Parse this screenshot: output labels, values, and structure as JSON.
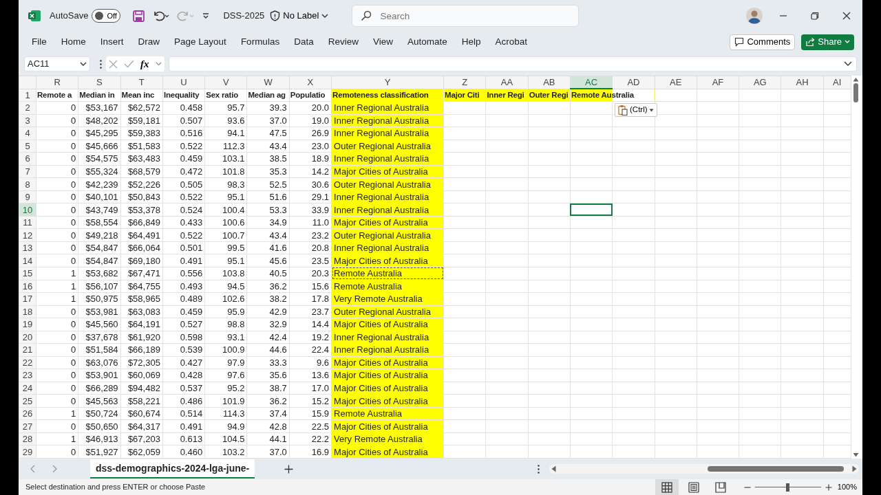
{
  "title_bar": {
    "autosave_label": "AutoSave",
    "autosave_on": false,
    "autosave_state": "Off",
    "file_name": "DSS-2025",
    "sensitivity": "No Label",
    "search_placeholder": "Search"
  },
  "ribbon_tabs": [
    "File",
    "Home",
    "Insert",
    "Draw",
    "Page Layout",
    "Formulas",
    "Data",
    "Review",
    "View",
    "Automate",
    "Help",
    "Acrobat"
  ],
  "ribbon_buttons": {
    "comments": "Comments",
    "share": "Share"
  },
  "formula_bar": {
    "name_box": "AC11",
    "function_symbol": "fx"
  },
  "sheet": {
    "columns": [
      {
        "label": "R",
        "selected": false
      },
      {
        "label": "S",
        "selected": false
      },
      {
        "label": "T",
        "selected": false
      },
      {
        "label": "U",
        "selected": false
      },
      {
        "label": "V",
        "selected": false
      },
      {
        "label": "W",
        "selected": false
      },
      {
        "label": "X",
        "selected": false
      },
      {
        "label": "Y",
        "selected": false
      },
      {
        "label": "Z",
        "selected": false
      },
      {
        "label": "AA",
        "selected": false
      },
      {
        "label": "AB",
        "selected": false
      },
      {
        "label": "AC",
        "selected": true
      },
      {
        "label": "AD",
        "selected": false
      },
      {
        "label": "AE",
        "selected": false
      },
      {
        "label": "AF",
        "selected": false
      },
      {
        "label": "AG",
        "selected": false
      },
      {
        "label": "AH",
        "selected": false
      },
      {
        "label": "AI",
        "selected": false
      }
    ],
    "header_row": {
      "number": "1",
      "cells": [
        {
          "text": "Remote a",
          "highlighted": false
        },
        {
          "text": "Median in",
          "highlighted": false
        },
        {
          "text": "Mean inc",
          "highlighted": false
        },
        {
          "text": "Inequality",
          "highlighted": false
        },
        {
          "text": "Sex ratio",
          "highlighted": false
        },
        {
          "text": "Median ag",
          "highlighted": false
        },
        {
          "text": "Populatio",
          "highlighted": false
        },
        {
          "text": "Remoteness classification",
          "highlighted": true
        },
        {
          "text": "Major Citi",
          "highlighted": true
        },
        {
          "text": "Inner Regi",
          "highlighted": true
        },
        {
          "text": "Outer Regi",
          "highlighted": true
        },
        {
          "text": "Remote Australia",
          "highlighted": true
        }
      ]
    },
    "rows": [
      {
        "number": "2",
        "selected": false,
        "copied": false,
        "values": [
          "0",
          "$53,167",
          "$62,572",
          "0.458",
          "95.7",
          "39.3",
          "20.0"
        ],
        "classification": "Inner Regional Australia"
      },
      {
        "number": "3",
        "selected": false,
        "copied": false,
        "values": [
          "0",
          "$48,202",
          "$59,181",
          "0.507",
          "93.6",
          "37.0",
          "19.0"
        ],
        "classification": "Inner Regional Australia"
      },
      {
        "number": "4",
        "selected": false,
        "copied": false,
        "values": [
          "0",
          "$45,295",
          "$59,383",
          "0.516",
          "94.1",
          "47.5",
          "26.9"
        ],
        "classification": "Inner Regional Australia"
      },
      {
        "number": "5",
        "selected": false,
        "copied": false,
        "values": [
          "0",
          "$45,666",
          "$51,583",
          "0.522",
          "112.3",
          "43.4",
          "23.0"
        ],
        "classification": "Outer Regional Australia"
      },
      {
        "number": "6",
        "selected": false,
        "copied": false,
        "values": [
          "0",
          "$54,575",
          "$63,483",
          "0.459",
          "103.1",
          "38.5",
          "18.9"
        ],
        "classification": "Inner Regional Australia"
      },
      {
        "number": "7",
        "selected": false,
        "copied": false,
        "values": [
          "0",
          "$55,324",
          "$68,579",
          "0.472",
          "101.8",
          "35.3",
          "14.2"
        ],
        "classification": "Major Cities of Australia"
      },
      {
        "number": "8",
        "selected": false,
        "copied": false,
        "values": [
          "0",
          "$42,239",
          "$52,226",
          "0.505",
          "98.3",
          "52.5",
          "30.6"
        ],
        "classification": "Outer Regional Australia"
      },
      {
        "number": "9",
        "selected": false,
        "copied": false,
        "values": [
          "0",
          "$40,101",
          "$50,843",
          "0.522",
          "95.1",
          "51.6",
          "29.1"
        ],
        "classification": "Inner Regional Australia"
      },
      {
        "number": "10",
        "selected": true,
        "copied": false,
        "values": [
          "0",
          "$43,749",
          "$53,378",
          "0.524",
          "100.4",
          "53.3",
          "33.9"
        ],
        "classification": "Inner Regional Australia"
      },
      {
        "number": "11",
        "selected": false,
        "copied": false,
        "values": [
          "0",
          "$58,554",
          "$66,849",
          "0.433",
          "100.6",
          "34.9",
          "11.0"
        ],
        "classification": "Major Cities of Australia"
      },
      {
        "number": "12",
        "selected": false,
        "copied": false,
        "values": [
          "0",
          "$49,218",
          "$64,491",
          "0.522",
          "100.7",
          "43.4",
          "23.2"
        ],
        "classification": "Outer Regional Australia"
      },
      {
        "number": "13",
        "selected": false,
        "copied": false,
        "values": [
          "0",
          "$54,847",
          "$66,064",
          "0.501",
          "99.5",
          "41.6",
          "20.8"
        ],
        "classification": "Inner Regional Australia"
      },
      {
        "number": "14",
        "selected": false,
        "copied": false,
        "values": [
          "0",
          "$54,847",
          "$69,180",
          "0.491",
          "95.1",
          "45.6",
          "23.5"
        ],
        "classification": "Major Cities of Australia"
      },
      {
        "number": "15",
        "selected": false,
        "copied": true,
        "values": [
          "1",
          "$53,682",
          "$67,471",
          "0.556",
          "103.8",
          "40.5",
          "20.3"
        ],
        "classification": "Remote Australia"
      },
      {
        "number": "16",
        "selected": false,
        "copied": false,
        "values": [
          "1",
          "$56,107",
          "$64,755",
          "0.493",
          "94.5",
          "36.2",
          "15.6"
        ],
        "classification": "Remote Australia"
      },
      {
        "number": "17",
        "selected": false,
        "copied": false,
        "values": [
          "1",
          "$50,975",
          "$58,965",
          "0.489",
          "102.6",
          "38.2",
          "17.8"
        ],
        "classification": "Very Remote Australia"
      },
      {
        "number": "18",
        "selected": false,
        "copied": false,
        "values": [
          "0",
          "$53,981",
          "$63,083",
          "0.459",
          "95.9",
          "42.9",
          "23.7"
        ],
        "classification": "Outer Regional Australia"
      },
      {
        "number": "19",
        "selected": false,
        "copied": false,
        "values": [
          "0",
          "$45,560",
          "$64,191",
          "0.527",
          "98.8",
          "32.9",
          "14.4"
        ],
        "classification": "Major Cities of Australia"
      },
      {
        "number": "20",
        "selected": false,
        "copied": false,
        "values": [
          "0",
          "$37,678",
          "$61,920",
          "0.598",
          "93.1",
          "42.4",
          "19.2"
        ],
        "classification": "Inner Regional Australia"
      },
      {
        "number": "21",
        "selected": false,
        "copied": false,
        "values": [
          "0",
          "$51,584",
          "$66,189",
          "0.539",
          "100.9",
          "44.6",
          "22.4"
        ],
        "classification": "Inner Regional Australia"
      },
      {
        "number": "22",
        "selected": false,
        "copied": false,
        "values": [
          "0",
          "$63,076",
          "$72,305",
          "0.427",
          "97.9",
          "33.3",
          "9.6"
        ],
        "classification": "Major Cities of Australia"
      },
      {
        "number": "23",
        "selected": false,
        "copied": false,
        "values": [
          "0",
          "$53,901",
          "$60,069",
          "0.428",
          "97.6",
          "35.6",
          "13.6"
        ],
        "classification": "Major Cities of Australia"
      },
      {
        "number": "24",
        "selected": false,
        "copied": false,
        "values": [
          "0",
          "$66,289",
          "$94,482",
          "0.537",
          "95.2",
          "38.7",
          "17.0"
        ],
        "classification": "Major Cities of Australia"
      },
      {
        "number": "25",
        "selected": false,
        "copied": false,
        "values": [
          "0",
          "$45,563",
          "$58,221",
          "0.486",
          "101.9",
          "36.2",
          "15.2"
        ],
        "classification": "Major Cities of Australia"
      },
      {
        "number": "26",
        "selected": false,
        "copied": false,
        "values": [
          "1",
          "$50,724",
          "$60,674",
          "0.514",
          "114.3",
          "37.4",
          "15.9"
        ],
        "classification": "Remote Australia"
      },
      {
        "number": "27",
        "selected": false,
        "copied": false,
        "values": [
          "0",
          "$50,650",
          "$64,317",
          "0.491",
          "94.9",
          "42.8",
          "22.5"
        ],
        "classification": "Major Cities of Australia"
      },
      {
        "number": "28",
        "selected": false,
        "copied": false,
        "values": [
          "1",
          "$46,913",
          "$67,203",
          "0.613",
          "104.5",
          "44.1",
          "22.2"
        ],
        "classification": "Very Remote Australia"
      },
      {
        "number": "29",
        "selected": false,
        "copied": false,
        "values": [
          "0",
          "$51,927",
          "$62,059",
          "0.460",
          "103.2",
          "37.0",
          "16.9"
        ],
        "classification": "Major Cities of Australia"
      }
    ],
    "classification_highlighted": true,
    "paste_options": "(Ctrl)"
  },
  "sheet_tabs": [
    {
      "label": "dss-demographics-2024-lga-june-",
      "selected": true
    }
  ],
  "status_bar": {
    "message": "Select destination and press ENTER or choose Paste",
    "views": [
      {
        "kind": "normal",
        "selected": true
      },
      {
        "kind": "page_layout",
        "selected": false
      },
      {
        "kind": "page_break",
        "selected": false
      }
    ],
    "zoom": {
      "level": 0.5,
      "reading": "100%"
    }
  }
}
